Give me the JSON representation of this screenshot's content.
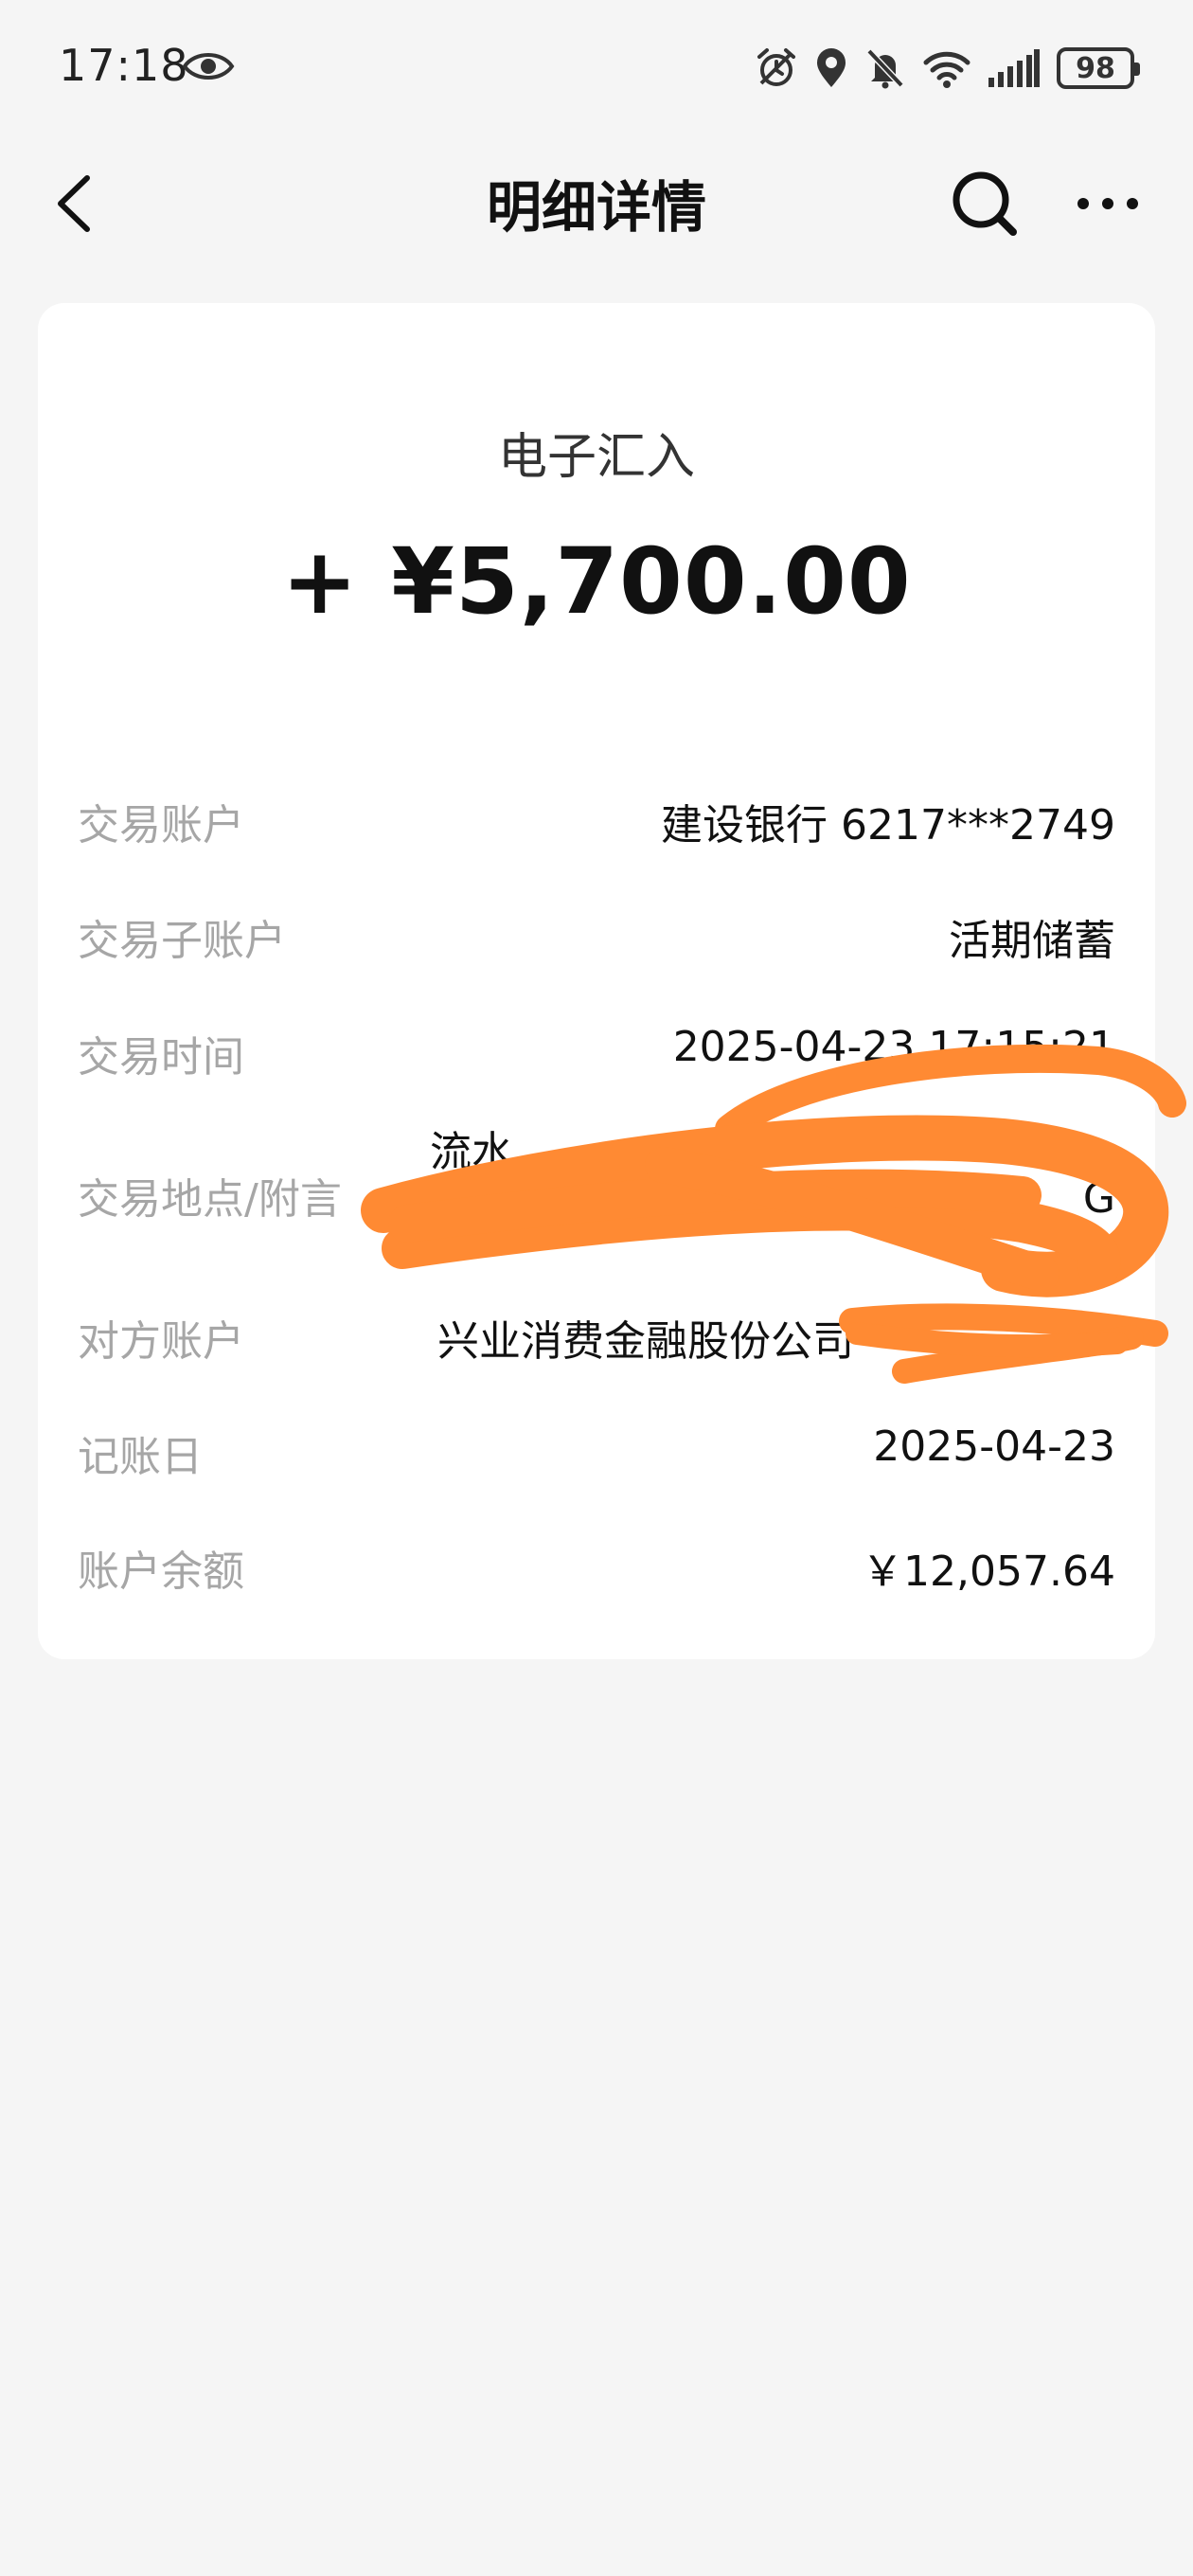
{
  "status_bar": {
    "time": "17:18",
    "battery": "98",
    "icons": [
      "eye-icon",
      "alarm-icon",
      "location-icon",
      "mute-icon",
      "wifi-icon",
      "signal-icon",
      "battery-icon"
    ]
  },
  "nav": {
    "title": "明细详情",
    "icons": [
      "back-icon",
      "search-icon",
      "more-icon"
    ]
  },
  "transaction": {
    "type": "电子汇入",
    "amount": "+ ¥5,700.00"
  },
  "details": {
    "account": {
      "label": "交易账户",
      "value": "建设银行 6217***2749"
    },
    "sub_account": {
      "label": "交易子账户",
      "value": "活期储蓄"
    },
    "time": {
      "label": "交易时间",
      "value": "2025-04-23 17:15:21"
    },
    "location": {
      "label": "交易地点/附言",
      "line1": "流水",
      "line2": "G"
    },
    "counterparty": {
      "label": "对方账户",
      "value": "兴业消费金融股份公司"
    },
    "posting_date": {
      "label": "记账日",
      "value": "2025-04-23"
    },
    "balance": {
      "label": "账户余额",
      "value": "￥12,057.64"
    }
  },
  "colors": {
    "background": "#f5f5f5",
    "card": "#ffffff",
    "label": "#a6a6a6",
    "redaction": "#ff8a33"
  }
}
